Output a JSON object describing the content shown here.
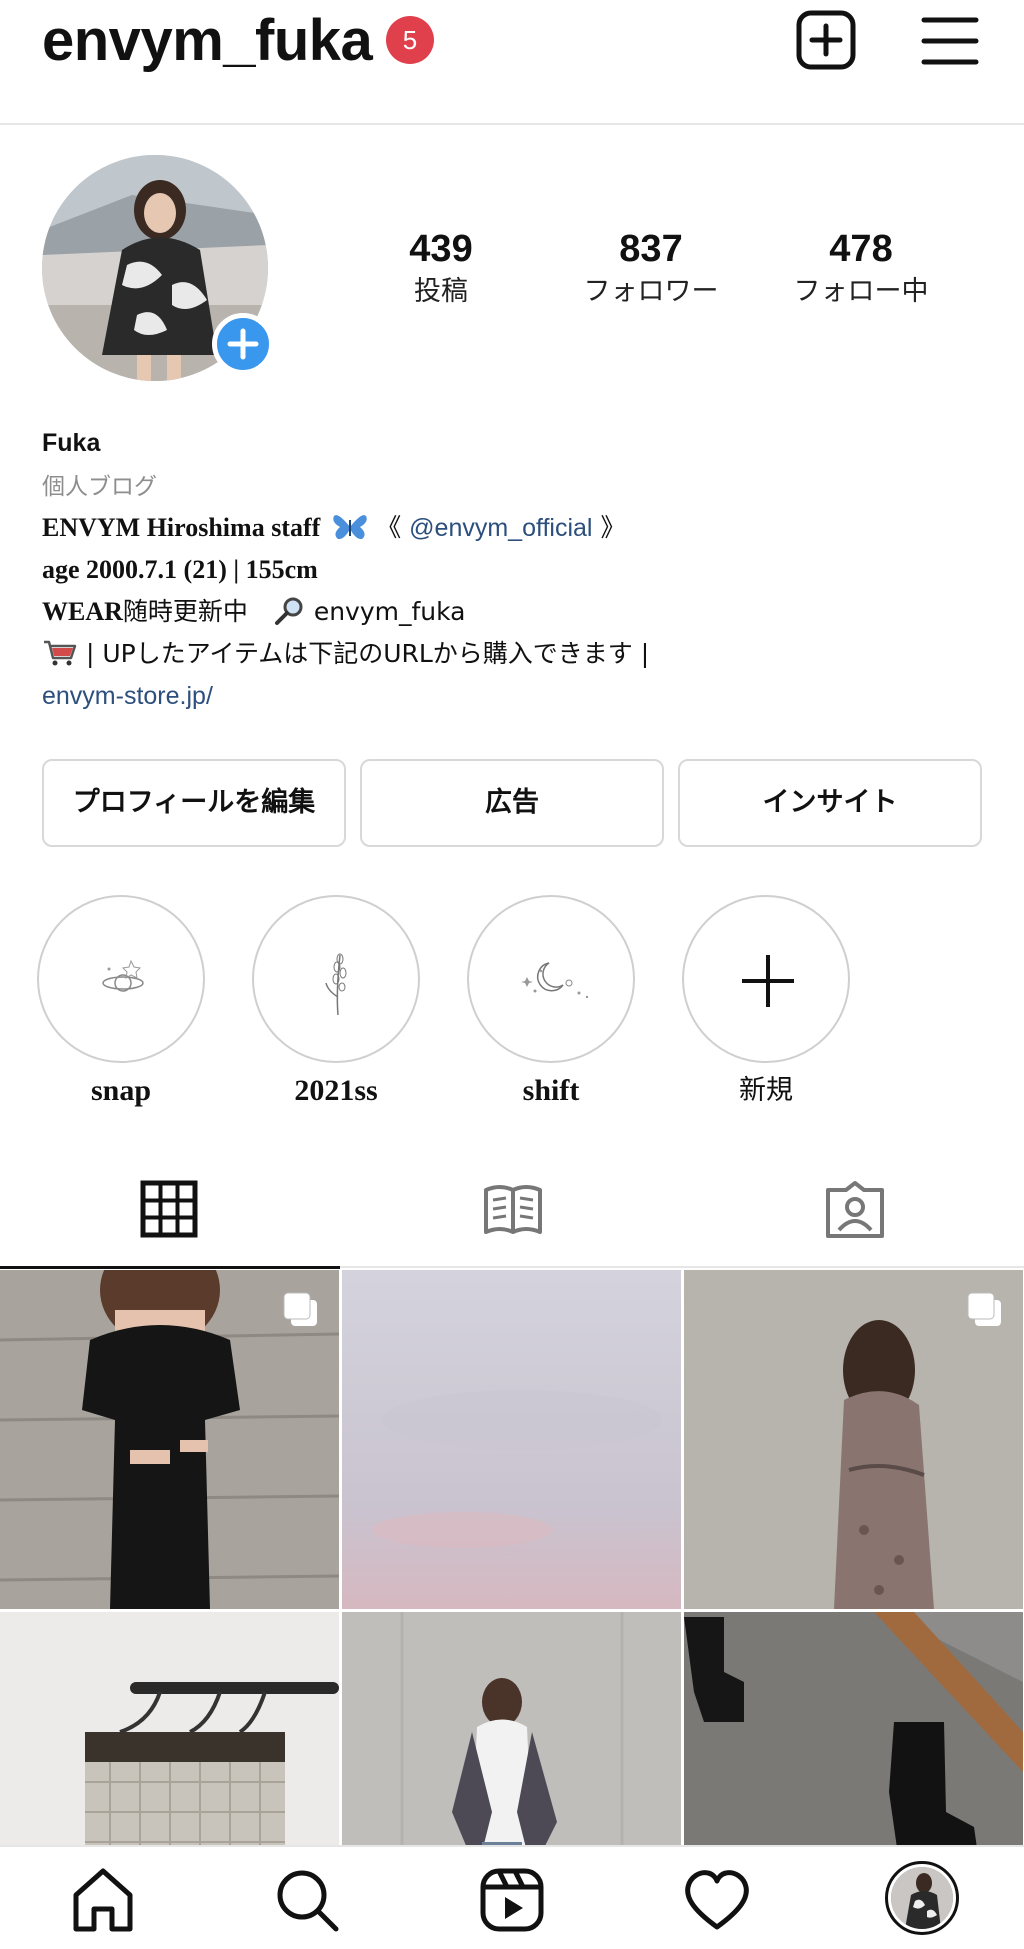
{
  "header": {
    "username": "envym_fuka",
    "notification_count": "5",
    "icons": [
      "plus-square-icon",
      "menu-icon"
    ]
  },
  "profile": {
    "stats": [
      {
        "value": "439",
        "label": "投稿"
      },
      {
        "value": "837",
        "label": "フォロワー"
      },
      {
        "value": "478",
        "label": "フォロー中"
      }
    ]
  },
  "bio": {
    "name": "Fuka",
    "category": "個人ブログ",
    "line1_prefix": "ENVYM Hiroshima staff",
    "line1_open": "《",
    "line1_mention": "@envym_official",
    "line1_close": "》",
    "line2": "age 2000.7.1 (21) | 155cm",
    "line3_bold": "WEAR",
    "line3_text": "随時更新中",
    "line3_handle": "envym_fuka",
    "line4": "| UPしたアイテムは下記のURLから購入できます |",
    "link": "envym-store.jp/"
  },
  "buttons": {
    "edit_profile": "プロフィールを編集",
    "ads": "広告",
    "insights": "インサイト"
  },
  "highlights": [
    {
      "label": "snap"
    },
    {
      "label": "2021ss"
    },
    {
      "label": "shift"
    },
    {
      "label": "新規"
    }
  ],
  "tabs": [
    "grid-icon",
    "guide-icon",
    "tagged-icon"
  ],
  "colors": {
    "badge": "#e0404c",
    "add_button": "#3a97ee",
    "link": "#2d4f7d",
    "muted": "#8e8e8e",
    "border": "#d8d8d8"
  },
  "bottom_nav": [
    "home-icon",
    "search-icon",
    "reels-icon",
    "heart-icon",
    "profile-avatar"
  ]
}
